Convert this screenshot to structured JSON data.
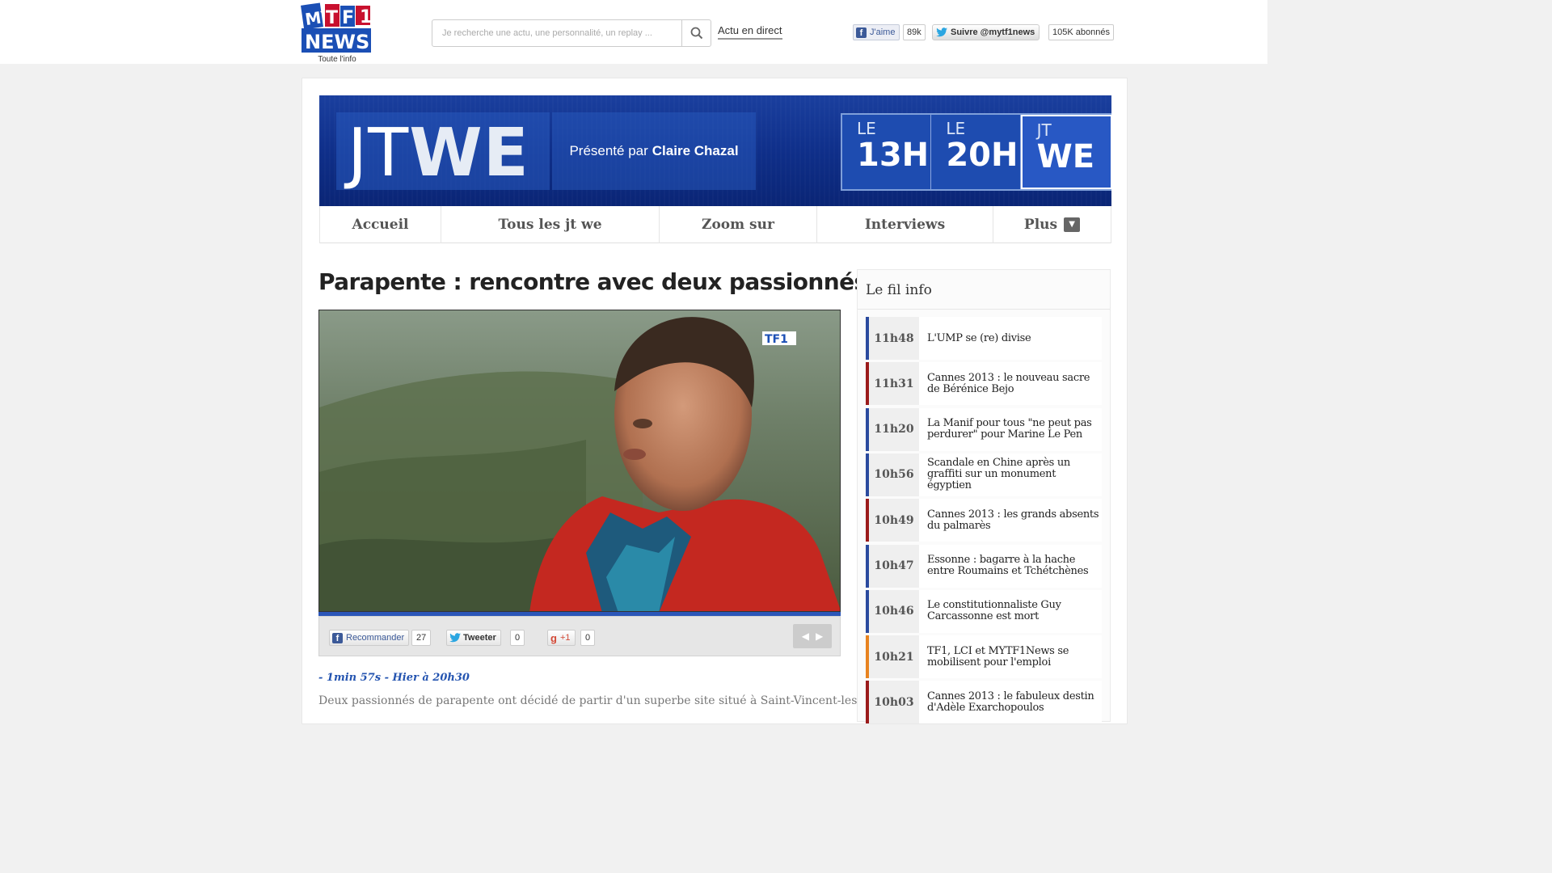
{
  "header": {
    "logo_text_top": "MYTF1",
    "logo_text_bottom": "NEWS",
    "logo_tagline": "Toute l'info",
    "search_placeholder": "Je recherche une actu, une personnalité, un replay ...",
    "actu_link": "Actu en direct",
    "fb_like_label": "J'aime",
    "fb_like_count": "89k",
    "twitter_follow_label": "Suivre @mytf1news",
    "twitter_followers": "105K abonnés"
  },
  "banner": {
    "jtwe_jt": "JT",
    "jtwe_we": "WE",
    "presented_prefix": "Présenté par",
    "presenter": "Claire Chazal",
    "tiles": [
      {
        "small": "LE",
        "big": "13H"
      },
      {
        "small": "LE",
        "big": "20H"
      },
      {
        "small": "JT",
        "big": "WE"
      }
    ]
  },
  "nav": {
    "items": [
      {
        "label": "Accueil"
      },
      {
        "label": "Tous les jt we"
      },
      {
        "label": "Zoom sur"
      },
      {
        "label": "Interviews"
      },
      {
        "label": "Plus"
      }
    ]
  },
  "article": {
    "title": "Parapente : rencontre avec deux passionnés",
    "video_channel_logo": "TF1",
    "video_progress": 1.0,
    "share": {
      "fb_label": "Recommander",
      "fb_count": "27",
      "tw_label": "Tweeter",
      "tw_count": "0",
      "gplus_label": "+1",
      "gplus_count": "0"
    },
    "meta": "- 1min 57s - Hier à 20h30",
    "description": "Deux passionnés de parapente ont décidé de partir d'un superbe site situé à Saint-Vincent-les-Forts."
  },
  "filinfo": {
    "title": "Le fil info",
    "items": [
      {
        "time": "11h48",
        "text": "L'UMP se (re) divise",
        "color": "#2a4a9e"
      },
      {
        "time": "11h31",
        "text": "Cannes 2013 : le nouveau sacre de Bérénice Bejo",
        "color": "#9b1b1b"
      },
      {
        "time": "11h20",
        "text": "La Manif pour tous \"ne peut pas perdurer\" pour Marine Le Pen",
        "color": "#2a4a9e"
      },
      {
        "time": "10h56",
        "text": "Scandale en Chine après un graffiti sur un monument égyptien",
        "color": "#2a4a9e"
      },
      {
        "time": "10h49",
        "text": "Cannes 2013 : les grands absents du palmarès",
        "color": "#9b1b1b"
      },
      {
        "time": "10h47",
        "text": "Essonne : bagarre à la hache entre Roumains et Tchétchènes",
        "color": "#2a4a9e"
      },
      {
        "time": "10h46",
        "text": "Le constitutionnaliste Guy Carcassonne est mort",
        "color": "#2a4a9e"
      },
      {
        "time": "10h21",
        "text": "TF1, LCI et MYTF1News se mobilisent pour l'emploi",
        "color": "#e8831f"
      },
      {
        "time": "10h03",
        "text": "Cannes 2013 : le fabuleux destin d'Adèle Exarchopoulos",
        "color": "#9b1b1b"
      }
    ]
  }
}
